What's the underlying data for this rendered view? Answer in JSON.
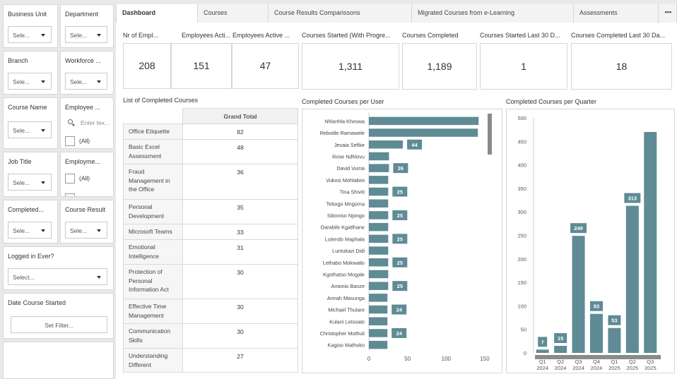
{
  "filters": {
    "business_unit": {
      "label": "Business Unit",
      "value": "Sele..."
    },
    "department": {
      "label": "Department",
      "value": "Sele..."
    },
    "branch": {
      "label": "Branch",
      "value": "Sele..."
    },
    "workforce": {
      "label": "Workforce ...",
      "value": "Sele..."
    },
    "course_name": {
      "label": "Course Name",
      "value": "Sele..."
    },
    "employee": {
      "label": "Employee ...",
      "placeholder": "Enter tex...",
      "all": "(All)"
    },
    "job_title": {
      "label": "Job Title",
      "value": "Sele..."
    },
    "employment": {
      "label": "Employme...",
      "all": "(All)"
    },
    "completed": {
      "label": "Completed...",
      "value": "Sele..."
    },
    "course_result": {
      "label": "Course Result",
      "value": "Sele..."
    },
    "logged_in": {
      "label": "Logged in Ever?",
      "value": "Select..."
    },
    "date_started": {
      "label": "Date Course Started",
      "button": "Set Filter..."
    }
  },
  "tabs": [
    "Dashboard",
    "Courses",
    "Course Results Comparissons",
    "Migrated Courses from e-Learning",
    "Assessments"
  ],
  "tab_more": "•••",
  "kpis": [
    {
      "title": "Nr of Empl...",
      "value": "208"
    },
    {
      "title": "Employees Acti...",
      "value": "151"
    },
    {
      "title": "Employees Active ...",
      "value": "47"
    },
    {
      "title": "Courses Started (With Progre...",
      "value": "1,311"
    },
    {
      "title": "Courses Completed",
      "value": "1,189"
    },
    {
      "title": "Courses Started Last 30 D...",
      "value": "1"
    },
    {
      "title": "Courses Completed Last 30 Da...",
      "value": "18"
    }
  ],
  "table": {
    "title": "List of Completed Courses",
    "header": "Grand Total",
    "rows": [
      {
        "name": "Office Etiquette",
        "value": "82"
      },
      {
        "name": "Basic Excel Assessment",
        "value": "48"
      },
      {
        "name": "Fraud Management in the Office",
        "value": "36"
      },
      {
        "name": "Personal Development",
        "value": "35"
      },
      {
        "name": "Microsoft Teams",
        "value": "33"
      },
      {
        "name": "Emotional Intelligence",
        "value": "31"
      },
      {
        "name": "Protection of Personal Information Act",
        "value": "30"
      },
      {
        "name": "Effective Time Management",
        "value": "30"
      },
      {
        "name": "Communication Skills",
        "value": "30"
      },
      {
        "name": "Understanding Different",
        "value": "27"
      }
    ]
  },
  "chart_data": [
    {
      "type": "bar",
      "orientation": "horizontal",
      "title": "Completed Courses per User",
      "categories": [
        "Nhlanhla Kheswa",
        "Rebotile Ramawele",
        "Jesaia Sefike",
        "Rose Ndhlovu",
        "David Vuma",
        "Vukosi Mohlabini",
        "Tina Shiviti",
        "Tebogo Mngoma",
        "Siboniso Njongo",
        "Oarabile Kgatlhane",
        "Lutendo Maphala",
        "Luntukazi Didi",
        "Lethabo Mokwatlo",
        "Kgothatso Mogale",
        "Antonio Banze",
        "Annah Masunga",
        "Michael Thulare",
        "Kulani Letsoalo",
        "Christopher Mothuli",
        "Kagiso Mathoko"
      ],
      "values": [
        142,
        141,
        44,
        26,
        26,
        25,
        25,
        25,
        25,
        25,
        25,
        25,
        25,
        25,
        25,
        24,
        24,
        24,
        24,
        24
      ],
      "labels": [
        "",
        "",
        "44",
        "",
        "26",
        "",
        "25",
        "",
        "25",
        "",
        "25",
        "",
        "25",
        "",
        "25",
        "",
        "24",
        "",
        "24",
        ""
      ],
      "xticks": [
        "0",
        "50",
        "100",
        "150"
      ],
      "xlim": [
        0,
        150
      ],
      "color": "#5f8b95"
    },
    {
      "type": "bar",
      "title": "Completed Courses per Quarter",
      "categories": [
        [
          "Q1",
          "2024"
        ],
        [
          "Q2",
          "2024"
        ],
        [
          "Q3",
          "2024"
        ],
        [
          "Q4",
          "2024"
        ],
        [
          "Q1",
          "2025"
        ],
        [
          "Q2",
          "2025"
        ],
        [
          "Q3",
          "2025"
        ]
      ],
      "values": [
        7,
        15,
        249,
        83,
        53,
        313,
        470
      ],
      "labels": [
        "7",
        "15",
        "249",
        "83",
        "53",
        "313",
        ""
      ],
      "yticks": [
        "0",
        "50",
        "100",
        "150",
        "200",
        "250",
        "300",
        "350",
        "400",
        "450",
        "500"
      ],
      "ylim": [
        0,
        500
      ],
      "color": "#5f8b95"
    }
  ]
}
